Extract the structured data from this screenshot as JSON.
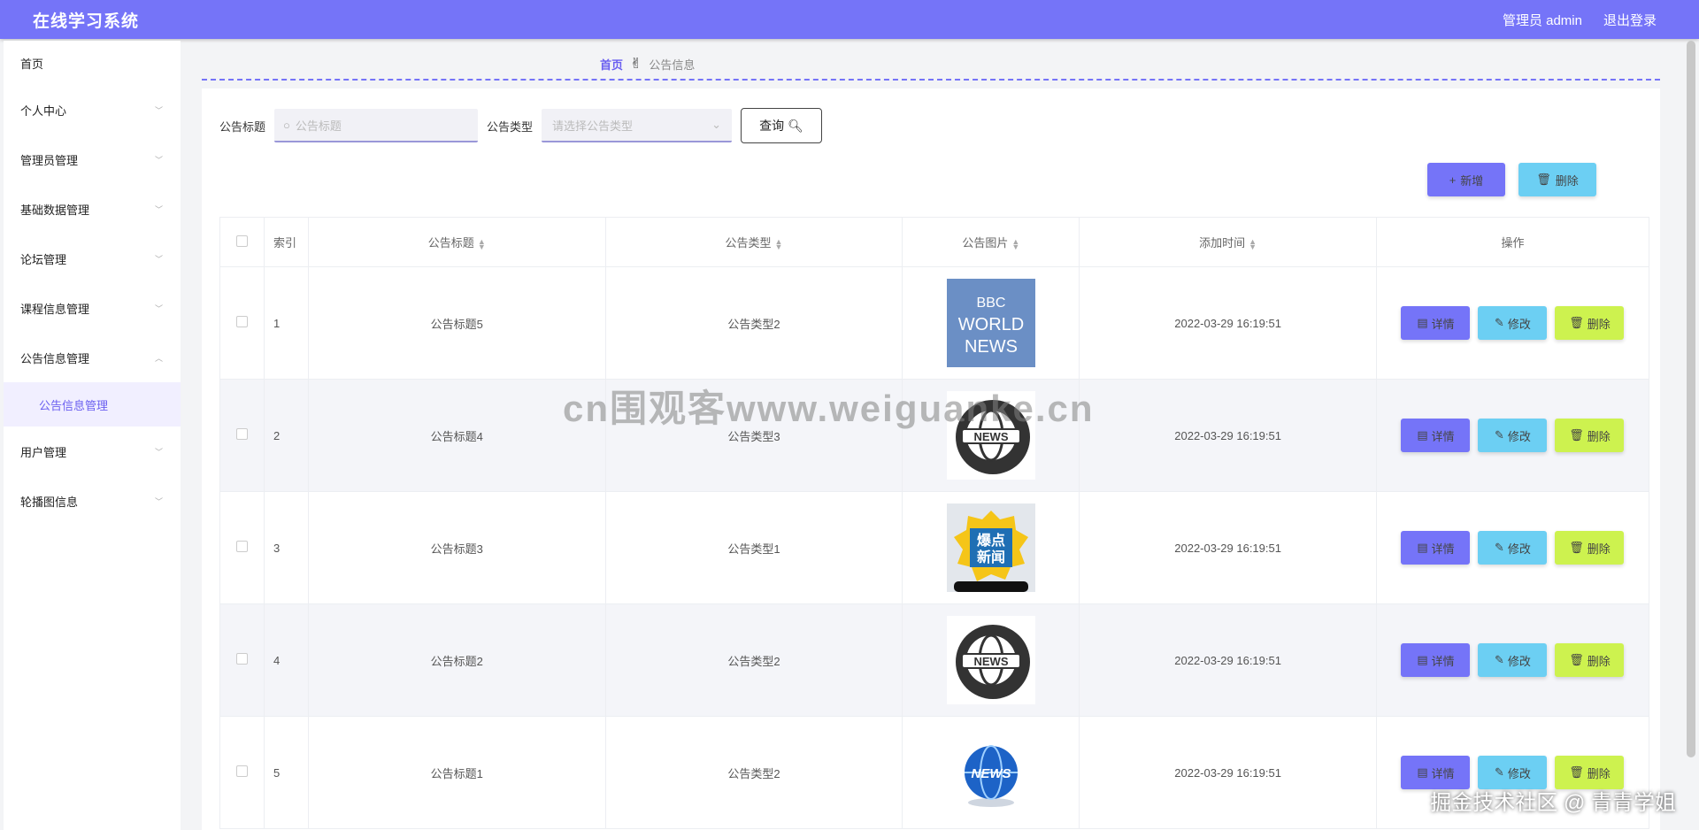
{
  "header": {
    "title": "在线学习系统",
    "user": "管理员 admin",
    "logout": "退出登录"
  },
  "sidebar": {
    "items": [
      {
        "label": "首页"
      },
      {
        "label": "个人中心"
      },
      {
        "label": "管理员管理"
      },
      {
        "label": "基础数据管理"
      },
      {
        "label": "论坛管理"
      },
      {
        "label": "课程信息管理"
      },
      {
        "label": "公告信息管理"
      },
      {
        "label": "用户管理"
      },
      {
        "label": "轮播图信息"
      }
    ],
    "active_sub": "公告信息管理"
  },
  "breadcrumb": {
    "home": "首页",
    "current": "公告信息"
  },
  "search": {
    "title_label": "公告标题",
    "title_placeholder": "公告标题",
    "type_label": "公告类型",
    "type_placeholder": "请选择公告类型",
    "query_label": "查询"
  },
  "actions": {
    "add_label": "新增",
    "delete_label": "删除"
  },
  "table": {
    "headers": [
      "索引",
      "公告标题",
      "公告类型",
      "公告图片",
      "添加时间",
      "操作"
    ],
    "rows": [
      {
        "index": "1",
        "title": "公告标题5",
        "type": "公告类型2",
        "image": "bbc-world-news",
        "time": "2022-03-29 16:19:51"
      },
      {
        "index": "2",
        "title": "公告标题4",
        "type": "公告类型3",
        "image": "news-globe-dark",
        "time": "2022-03-29 16:19:51"
      },
      {
        "index": "3",
        "title": "公告标题3",
        "type": "公告类型1",
        "image": "baodian-xinwen",
        "time": "2022-03-29 16:19:51"
      },
      {
        "index": "4",
        "title": "公告标题2",
        "type": "公告类型2",
        "image": "news-globe-dark",
        "time": "2022-03-29 16:19:51"
      },
      {
        "index": "5",
        "title": "公告标题1",
        "type": "公告类型2",
        "image": "news-globe-blue",
        "time": "2022-03-29 16:19:51"
      }
    ],
    "op_labels": {
      "detail": "详情",
      "edit": "修改",
      "delete": "删除"
    }
  },
  "image_text": {
    "bbc": [
      "BBC",
      "WORLD",
      "NEWS"
    ],
    "news": "NEWS",
    "baodian": [
      "爆点",
      "新闻"
    ]
  },
  "watermark": "cn围观客www.weiguanke.cn",
  "footer_mark": "掘金技术社区 @ 青青学姐"
}
